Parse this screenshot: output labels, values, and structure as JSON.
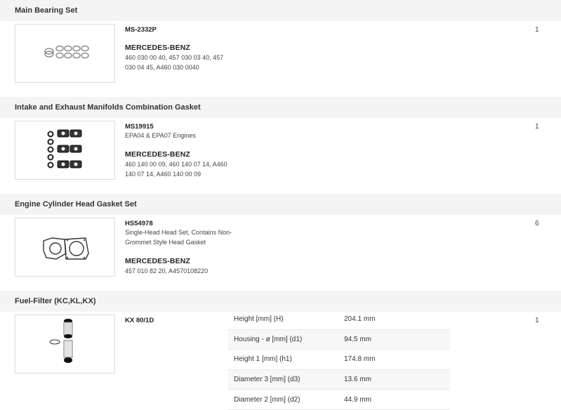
{
  "sections": [
    {
      "title": "Main Bearing Set",
      "part_number": "MS-2332P",
      "description": "",
      "brand": "MERCEDES-BENZ",
      "oe_numbers": "460 030 00 40, 457 030 03 40, 457 030 04 45, A460 030 0040",
      "quantity": "1"
    },
    {
      "title": "Intake and Exhaust Manifolds Combination Gasket",
      "part_number": "MS19915",
      "description": "EPA04 & EPA07 Engines",
      "brand": "MERCEDES-BENZ",
      "oe_numbers": "460 140 00 09, 460 140 07 14, A460 140 07 14, A460 140 00 09",
      "quantity": "1"
    },
    {
      "title": "Engine Cylinder Head Gasket Set",
      "part_number": "HS54978",
      "description": "Single-Head Head Set, Contains Non-Grommet Style Head Gasket",
      "brand": "MERCEDES-BENZ",
      "oe_numbers": "457 010 82 20, A4570108220",
      "quantity": "6"
    },
    {
      "title": "Fuel-Filter (KC,KL,KX)",
      "part_number": "KX 80/1D",
      "quantity": "1",
      "specs": [
        {
          "label": "Height [mm] (H)",
          "value": "204.1 mm"
        },
        {
          "label": "Housing - ø [mm] (d1)",
          "value": "94.5 mm"
        },
        {
          "label": "Height 1 [mm] (h1)",
          "value": "174.8 mm"
        },
        {
          "label": "Diameter 3 [mm] (d3)",
          "value": "13.6 mm"
        },
        {
          "label": "Diameter 2 [mm] (d2)",
          "value": "44.9 mm"
        }
      ]
    }
  ]
}
